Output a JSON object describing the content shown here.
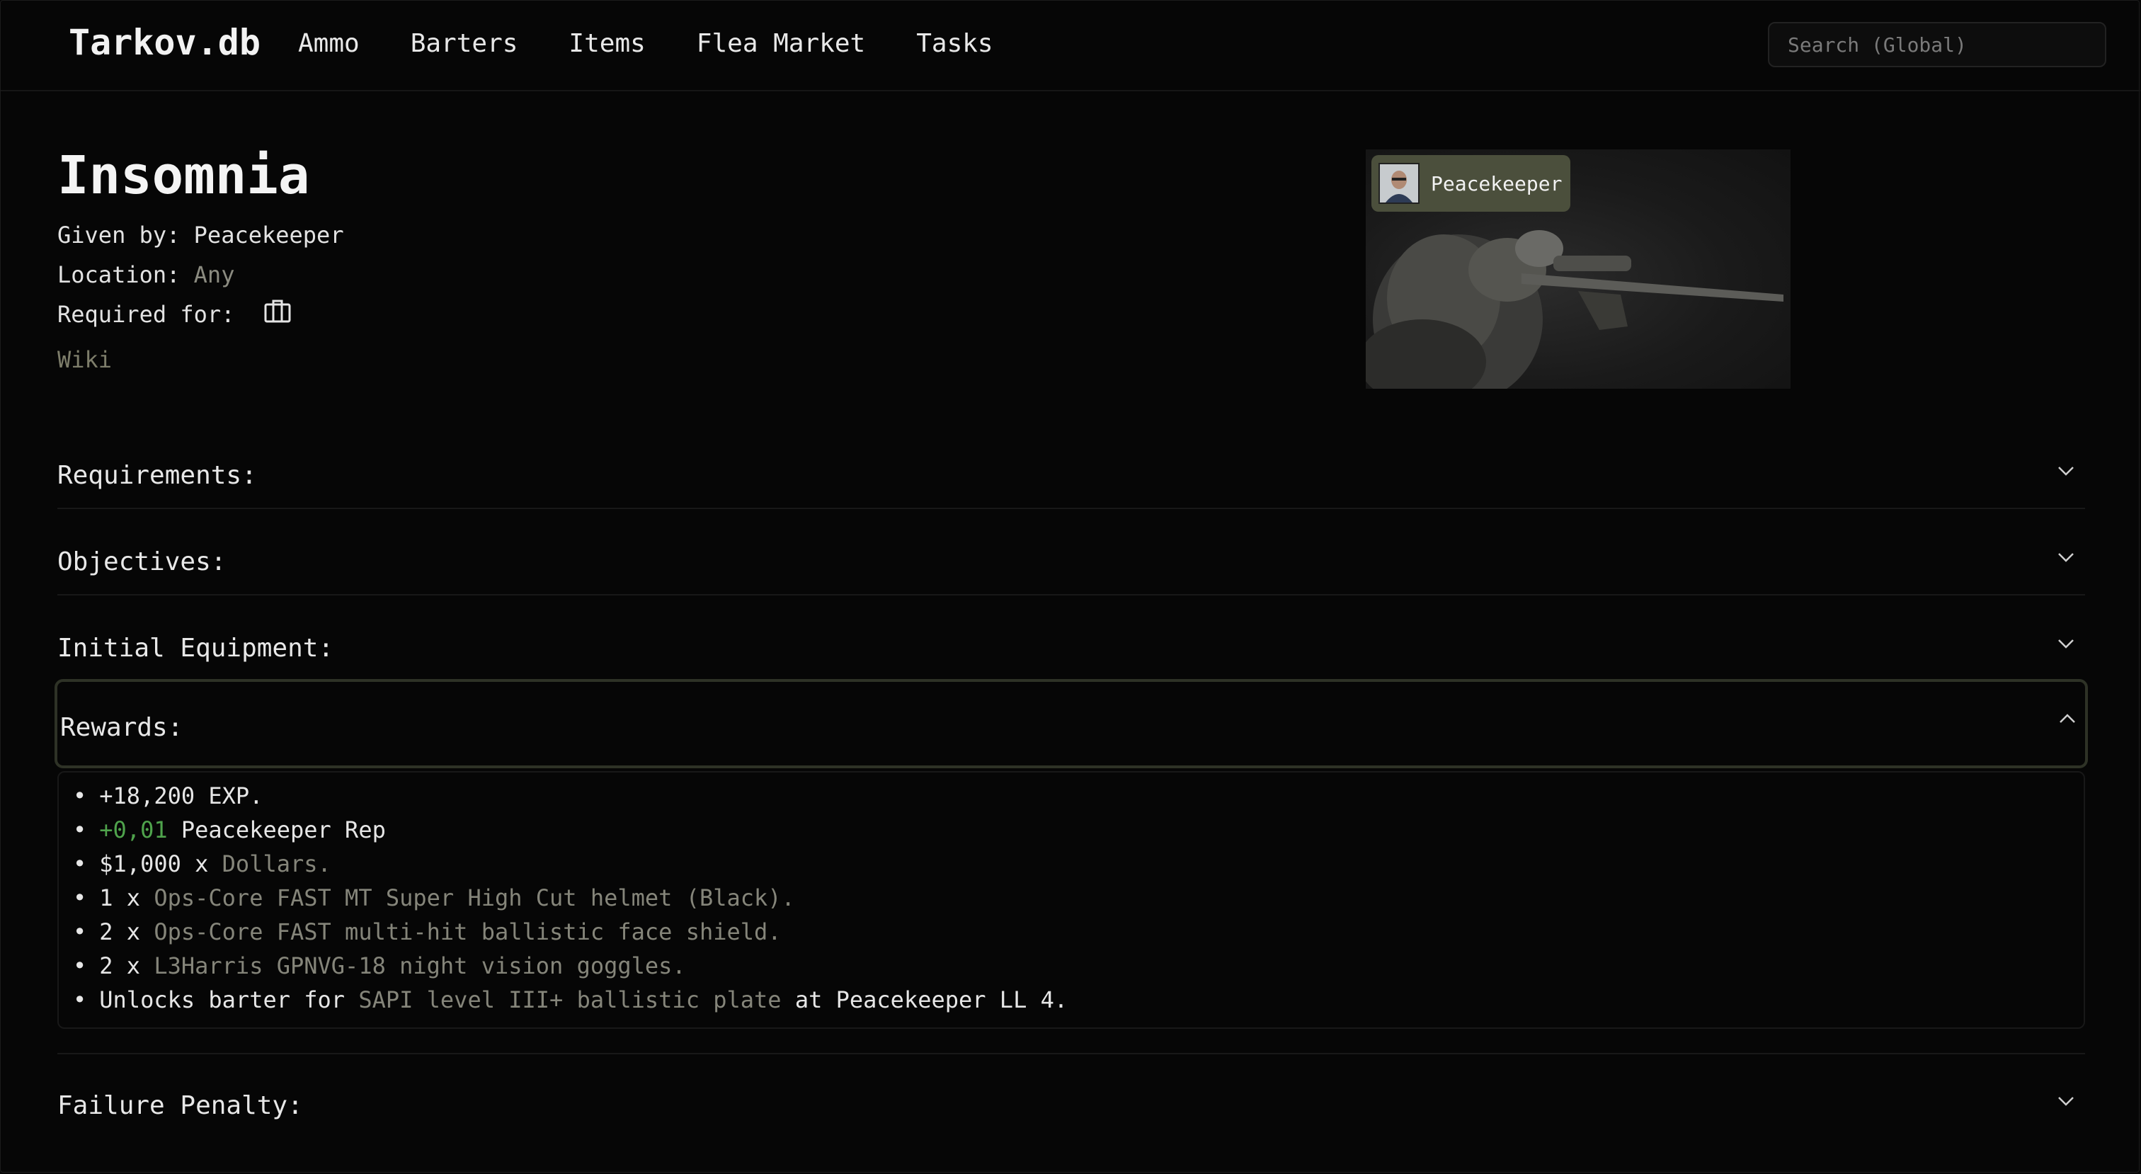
{
  "header": {
    "brand": "Tarkov.db",
    "nav": [
      "Ammo",
      "Barters",
      "Items",
      "Flea Market",
      "Tasks"
    ],
    "search_placeholder": "Search (Global)"
  },
  "task": {
    "title": "Insomnia",
    "given_by_label": "Given by:",
    "given_by_value": "Peacekeeper",
    "location_label": "Location:",
    "location_value": "Any",
    "required_for_label": "Required for:",
    "wiki_link": "Wiki"
  },
  "trader_card": {
    "trader_name": "Peacekeeper"
  },
  "sections": {
    "requirements": "Requirements:",
    "objectives": "Objectives:",
    "initial_equipment": "Initial Equipment:",
    "rewards": "Rewards:",
    "failure_penalty": "Failure Penalty:"
  },
  "rewards": {
    "bullet": "•",
    "exp": "+18,200 EXP.",
    "rep_value": "+0,01",
    "rep_label": "Peacekeeper Rep",
    "money_prefix": "$1,000 x",
    "money_item": "Dollars.",
    "items": [
      {
        "qty": "1 x",
        "name": "Ops-Core FAST MT Super High Cut helmet (Black)."
      },
      {
        "qty": "2 x",
        "name": "Ops-Core FAST multi-hit ballistic face shield."
      },
      {
        "qty": "2 x",
        "name": "L3Harris GPNVG-18 night vision goggles."
      }
    ],
    "unlock_prefix": "Unlocks barter for",
    "unlock_item": "SAPI level III+ ballistic plate",
    "unlock_suffix": "at Peacekeeper LL 4."
  },
  "colors": {
    "background": "#060606",
    "accent_muted": "#85857a",
    "rep_green": "#4fa34c",
    "badge_bg": "#4b4f3c",
    "open_section_border": "#2e3226"
  }
}
